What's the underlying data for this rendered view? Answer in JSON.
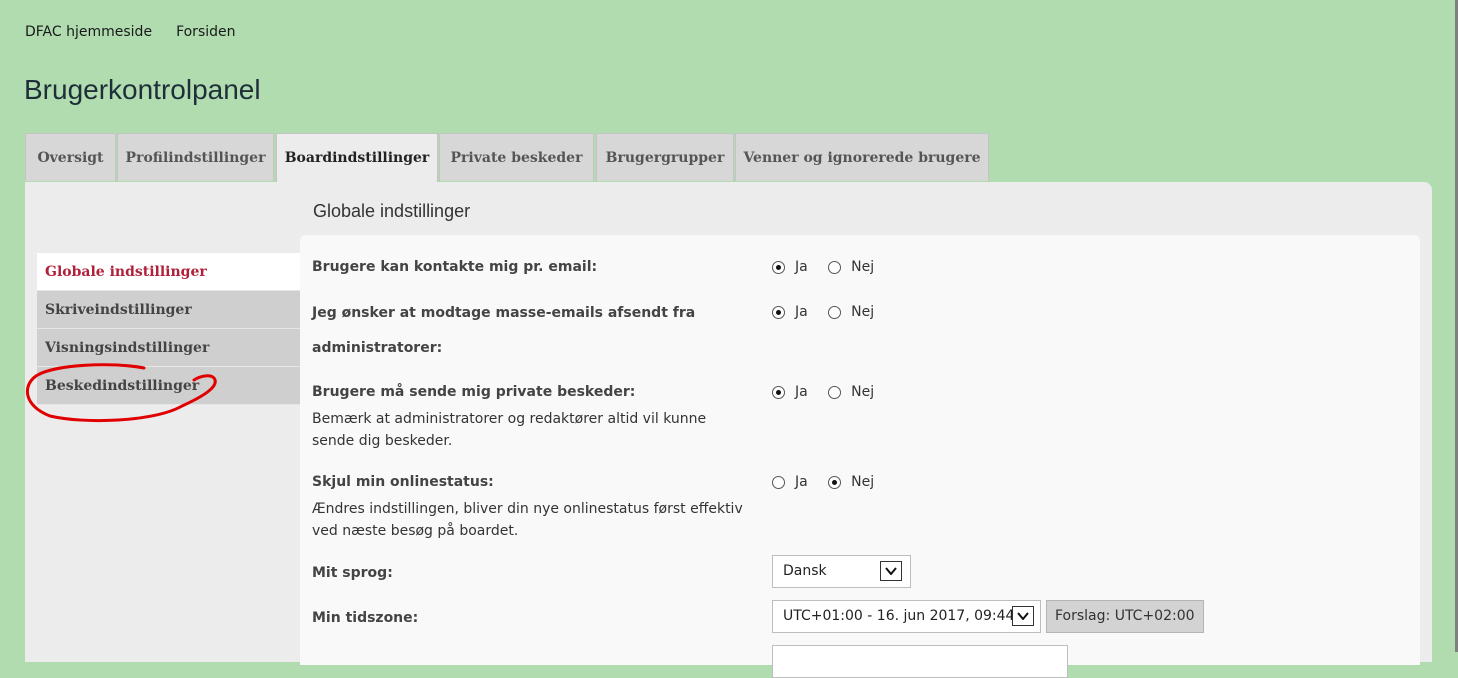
{
  "breadcrumb": {
    "home": "DFAC hjemmeside",
    "forum": "Forsiden"
  },
  "page_title": "Brugerkontrolpanel",
  "tabs": [
    {
      "label": "Oversigt"
    },
    {
      "label": "Profilindstillinger"
    },
    {
      "label": "Boardindstillinger"
    },
    {
      "label": "Private beskeder"
    },
    {
      "label": "Brugergrupper"
    },
    {
      "label": "Venner og ignorerede brugere"
    }
  ],
  "active_tab": "Boardindstillinger",
  "section_title": "Globale indstillinger",
  "sidenav": [
    {
      "label": "Globale indstillinger"
    },
    {
      "label": "Skriveindstillinger"
    },
    {
      "label": "Visningsindstillinger"
    },
    {
      "label": "Beskedindstillinger"
    }
  ],
  "active_sidenav": "Globale indstillinger",
  "radio_labels": {
    "yes": "Ja",
    "no": "Nej"
  },
  "settings": {
    "email_contact": {
      "label": "Brugere kan kontakte mig pr. email:",
      "value": "Ja"
    },
    "mass_email": {
      "label_line1": "Jeg ønsker at modtage masse-emails afsendt fra",
      "label_line2": "administratorer:",
      "value": "Ja"
    },
    "private_msgs": {
      "label": "Brugere må sende mig private beskeder:",
      "explain": "Bemærk at administratorer og redaktører altid vil kunne sende dig beskeder.",
      "value": "Ja"
    },
    "hide_online": {
      "label": "Skjul min onlinestatus:",
      "explain": "Ændres indstillingen, bliver din nye onlinestatus først effektiv ved næste besøg på boardet.",
      "value": "Nej"
    },
    "language": {
      "label": "Mit sprog:",
      "value": "Dansk"
    },
    "timezone": {
      "label": "Min tidszone:",
      "value": "UTC+01:00 - 16. jun 2017, 09:44",
      "suggest": "Forslag: UTC+02:00"
    }
  },
  "annotation_color": "#e00000"
}
